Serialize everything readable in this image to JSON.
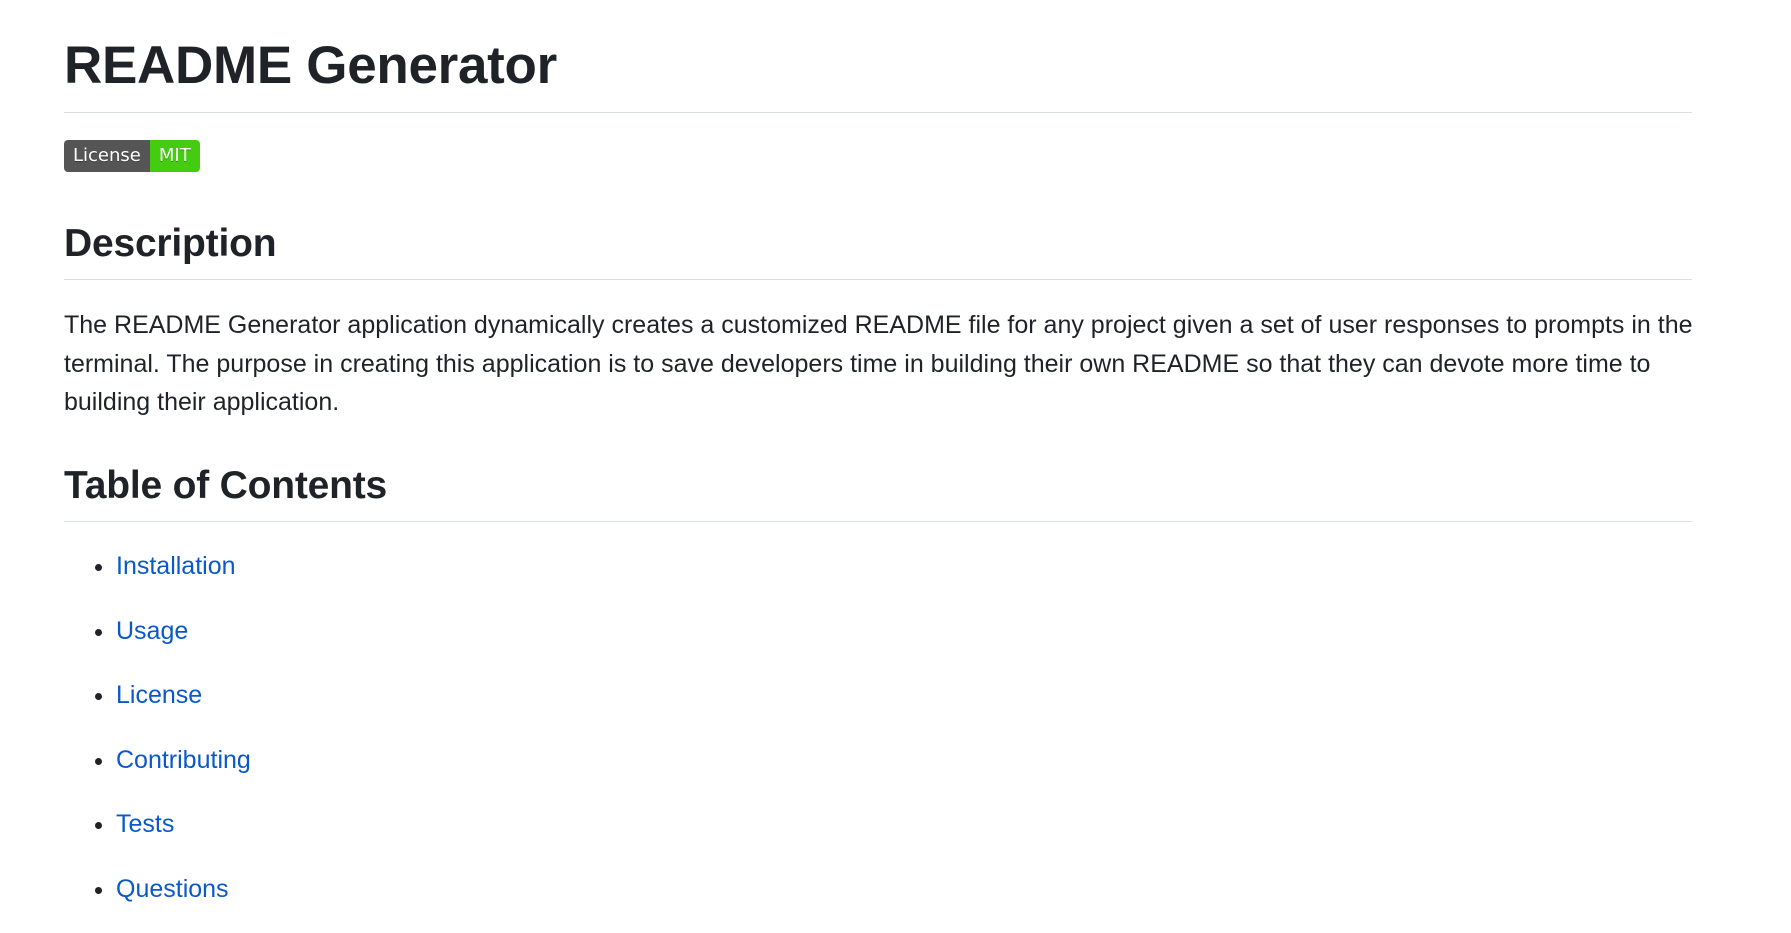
{
  "title": "README Generator",
  "badge": {
    "label": "License",
    "value": "MIT",
    "label_color": "#555555",
    "value_color": "#44cc11"
  },
  "sections": {
    "description": {
      "heading": "Description",
      "text": "The README Generator application dynamically creates a customized README file for any project given a set of user responses to prompts in the terminal. The purpose in creating this application is to save developers time in building their own README so that they can devote more time to building their application."
    },
    "toc": {
      "heading": "Table of Contents",
      "items": [
        "Installation",
        "Usage",
        "License",
        "Contributing",
        "Tests",
        "Questions"
      ]
    }
  },
  "colors": {
    "text": "#1f2328",
    "link": "#0a58ca",
    "rule": "#d8dee4"
  }
}
